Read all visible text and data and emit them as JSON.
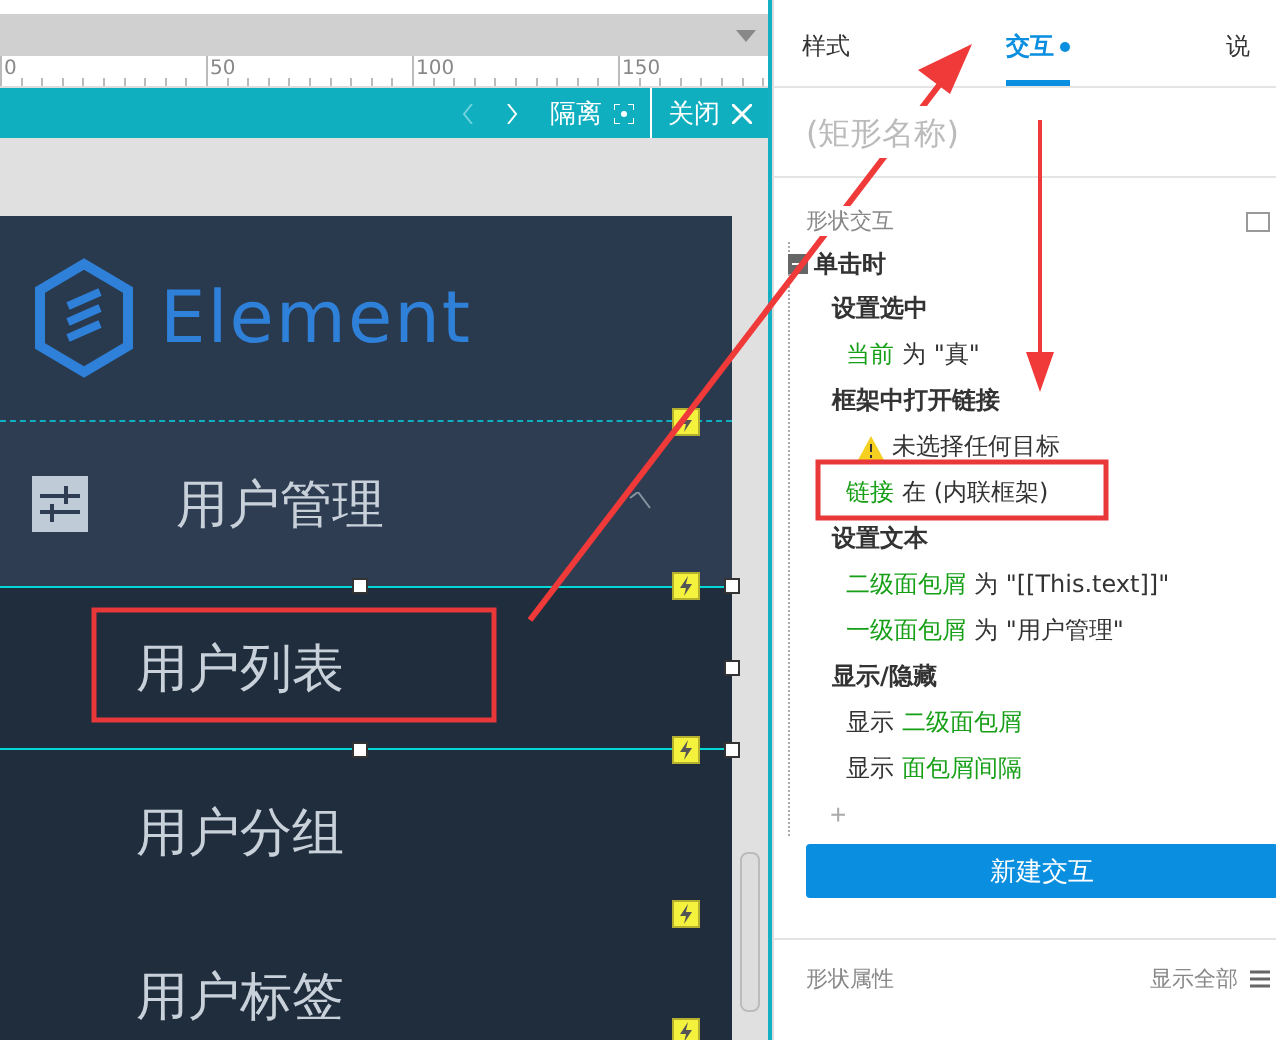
{
  "canvas": {
    "ruler_labels": [
      "0",
      "50",
      "100",
      "150"
    ],
    "toolbar": {
      "isolate": "隔离",
      "close": "关闭"
    }
  },
  "menu": {
    "logo": "Element",
    "groups": [
      {
        "label": "用户管理",
        "expanded": true,
        "children": [
          {
            "label": "用户列表",
            "selected": true
          },
          {
            "label": "用户分组",
            "selected": false
          },
          {
            "label": "用户标签",
            "selected": false
          }
        ]
      }
    ]
  },
  "inspector": {
    "tabs": [
      {
        "label": "样式",
        "selected": false,
        "dot": false
      },
      {
        "label": "交互",
        "selected": true,
        "dot": true
      },
      {
        "label": "说",
        "selected": false,
        "dot": false
      }
    ],
    "name_placeholder": "(矩形名称)",
    "section": "形状交互",
    "event": {
      "label": "单击时",
      "expanded": true,
      "actions": [
        {
          "title": "设置选中",
          "details": [
            {
              "kind": "line",
              "parts": [
                {
                  "kind": "target",
                  "text": "当前"
                },
                {
                  "kind": "plain",
                  "text": "为 \"真\""
                }
              ]
            }
          ]
        },
        {
          "title": "框架中打开链接",
          "details": [
            {
              "kind": "warning",
              "parts": [
                {
                  "kind": "plain",
                  "text": "未选择任何目标"
                }
              ]
            },
            {
              "kind": "line",
              "parts": [
                {
                  "kind": "target",
                  "text": "链接"
                },
                {
                  "kind": "plain",
                  "text": "在 (内联框架)"
                }
              ]
            }
          ]
        },
        {
          "title": "设置文本",
          "details": [
            {
              "kind": "line",
              "parts": [
                {
                  "kind": "target",
                  "text": "二级面包屑"
                },
                {
                  "kind": "plain",
                  "text": "为 \"[[This.text]]\""
                }
              ]
            },
            {
              "kind": "line",
              "parts": [
                {
                  "kind": "target",
                  "text": "一级面包屑"
                },
                {
                  "kind": "plain",
                  "text": "为 \"用户管理\""
                }
              ]
            }
          ]
        },
        {
          "title": "显示/隐藏",
          "details": [
            {
              "kind": "line",
              "parts": [
                {
                  "kind": "plain",
                  "text": "显示"
                },
                {
                  "kind": "target",
                  "text": "二级面包屑"
                }
              ]
            },
            {
              "kind": "line",
              "parts": [
                {
                  "kind": "plain",
                  "text": "显示"
                },
                {
                  "kind": "target",
                  "text": "面包屑间隔"
                }
              ]
            }
          ]
        }
      ]
    },
    "add": "+",
    "new_button": "新建交互",
    "properties": {
      "label": "形状属性",
      "show_all": "显示全部"
    }
  }
}
